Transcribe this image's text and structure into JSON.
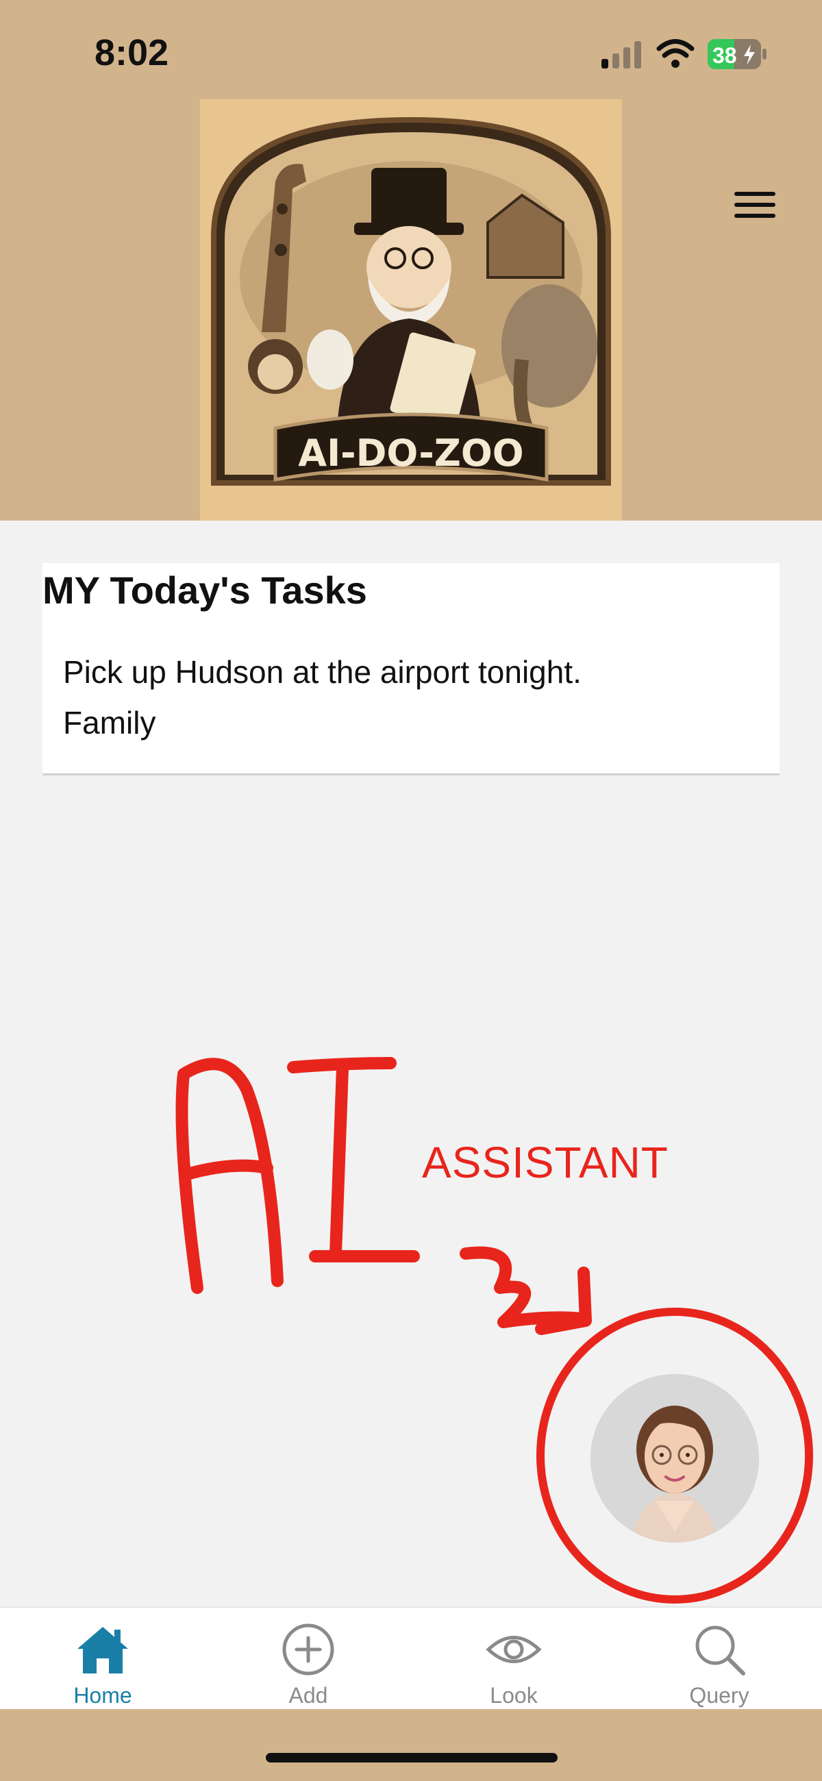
{
  "status_bar": {
    "time": "8:02",
    "battery": "38",
    "signal_icon": "signal-bars-icon",
    "wifi_icon": "wifi-icon",
    "battery_icon": "battery-charging-icon"
  },
  "header": {
    "logo_text": "AI-DO-ZOO",
    "menu_icon": "hamburger-menu-icon"
  },
  "tasks": {
    "title": "MY Today's Tasks",
    "items": [
      {
        "text": "Pick up Hudson at the airport tonight.",
        "category": "Family"
      }
    ]
  },
  "annotation": {
    "handwritten": "AI",
    "label": "ASSISTANT"
  },
  "assistant": {
    "icon": "ai-assistant-avatar-icon"
  },
  "tabbar": {
    "tabs": [
      {
        "label": "Home",
        "icon": "home-icon",
        "active": true
      },
      {
        "label": "Add",
        "icon": "add-circle-icon",
        "active": false
      },
      {
        "label": "Look",
        "icon": "eye-icon",
        "active": false
      },
      {
        "label": "Query",
        "icon": "search-icon",
        "active": false
      }
    ]
  },
  "colors": {
    "header_bg": "#d2b48c",
    "accent": "#1a7fa6",
    "annotation_red": "#e8251c",
    "battery_green": "#34c759"
  }
}
